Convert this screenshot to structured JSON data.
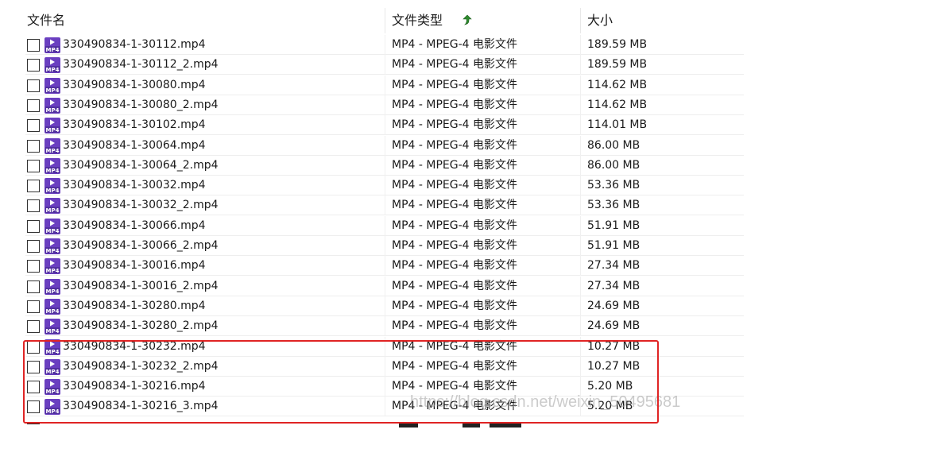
{
  "columns": {
    "name": "文件名",
    "type": "文件类型",
    "size": "大小"
  },
  "sort": {
    "column": "type",
    "icon": "sort-up-arrow-icon",
    "color": "#2e8b2e"
  },
  "icon_color": "#6a3fc0",
  "highlight_color": "#e02424",
  "rows": [
    {
      "name": "330490834-1-30112.mp4",
      "type": "MP4 - MPEG-4 电影文件",
      "size": "189.59 MB"
    },
    {
      "name": "330490834-1-30112_2.mp4",
      "type": "MP4 - MPEG-4 电影文件",
      "size": "189.59 MB"
    },
    {
      "name": "330490834-1-30080.mp4",
      "type": "MP4 - MPEG-4 电影文件",
      "size": "114.62 MB"
    },
    {
      "name": "330490834-1-30080_2.mp4",
      "type": "MP4 - MPEG-4 电影文件",
      "size": "114.62 MB"
    },
    {
      "name": "330490834-1-30102.mp4",
      "type": "MP4 - MPEG-4 电影文件",
      "size": "114.01 MB"
    },
    {
      "name": "330490834-1-30064.mp4",
      "type": "MP4 - MPEG-4 电影文件",
      "size": "86.00 MB"
    },
    {
      "name": "330490834-1-30064_2.mp4",
      "type": "MP4 - MPEG-4 电影文件",
      "size": "86.00 MB"
    },
    {
      "name": "330490834-1-30032.mp4",
      "type": "MP4 - MPEG-4 电影文件",
      "size": "53.36 MB"
    },
    {
      "name": "330490834-1-30032_2.mp4",
      "type": "MP4 - MPEG-4 电影文件",
      "size": "53.36 MB"
    },
    {
      "name": "330490834-1-30066.mp4",
      "type": "MP4 - MPEG-4 电影文件",
      "size": "51.91 MB"
    },
    {
      "name": "330490834-1-30066_2.mp4",
      "type": "MP4 - MPEG-4 电影文件",
      "size": "51.91 MB"
    },
    {
      "name": "330490834-1-30016.mp4",
      "type": "MP4 - MPEG-4 电影文件",
      "size": "27.34 MB"
    },
    {
      "name": "330490834-1-30016_2.mp4",
      "type": "MP4 - MPEG-4 电影文件",
      "size": "27.34 MB"
    },
    {
      "name": "330490834-1-30280.mp4",
      "type": "MP4 - MPEG-4 电影文件",
      "size": "24.69 MB"
    },
    {
      "name": "330490834-1-30280_2.mp4",
      "type": "MP4 - MPEG-4 电影文件",
      "size": "24.69 MB"
    },
    {
      "name": "330490834-1-30232.mp4",
      "type": "MP4 - MPEG-4 电影文件",
      "size": "10.27 MB"
    },
    {
      "name": "330490834-1-30232_2.mp4",
      "type": "MP4 - MPEG-4 电影文件",
      "size": "10.27 MB"
    },
    {
      "name": "330490834-1-30216.mp4",
      "type": "MP4 - MPEG-4 电影文件",
      "size": "5.20 MB"
    },
    {
      "name": "330490834-1-30216_3.mp4",
      "type": "MP4 - MPEG-4 电影文件",
      "size": "5.20 MB"
    }
  ],
  "watermark": "https://blog.csdn.net/weixin_50495681"
}
